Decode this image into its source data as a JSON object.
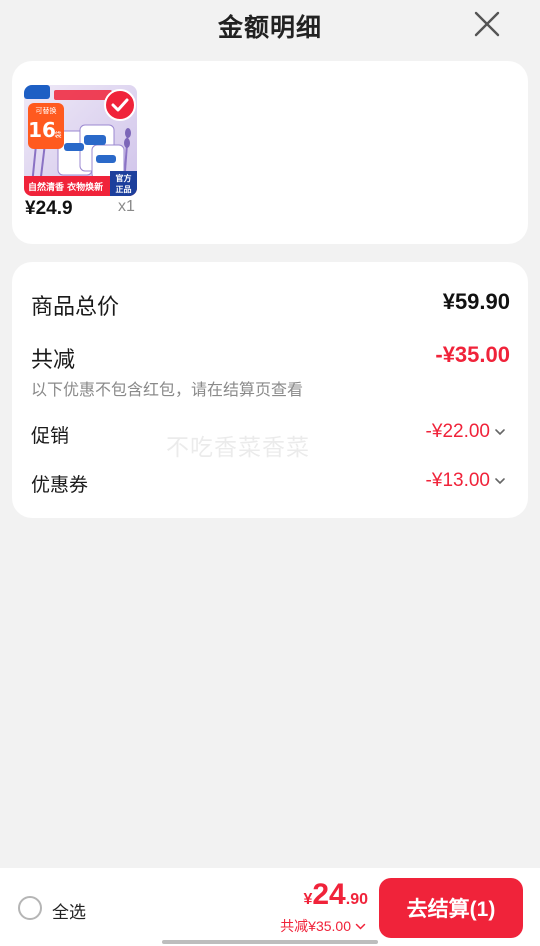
{
  "header": {
    "title": "金额明细"
  },
  "product": {
    "price": "¥24.9",
    "quantity": "x1",
    "image": {
      "badge_top": "可替换",
      "badge_count": "16",
      "badge_unit": "袋",
      "strip_left": "自然清香 衣物焕新",
      "strip_right_1": "官方",
      "strip_right_2": "正品",
      "accent_color": "#7c66b8"
    }
  },
  "summary": {
    "total_label": "商品总价",
    "total_value": "¥59.90",
    "discount_label": "共减",
    "discount_value": "-¥35.00",
    "note": "以下优惠不包含红包，请在结算页查看",
    "promo_label": "促销",
    "promo_value": "-¥22.00",
    "coupon_label": "优惠券",
    "coupon_value": "-¥13.00"
  },
  "watermark": "不吃香菜香菜",
  "bottom": {
    "select_all": "全选",
    "currency": "¥",
    "total_int": "24",
    "total_dec": ".90",
    "saved": "共减¥35.00",
    "checkout": "去结算(1)"
  },
  "colors": {
    "accent": "#f0233a",
    "background": "#f2f2f2",
    "card": "#ffffff"
  }
}
